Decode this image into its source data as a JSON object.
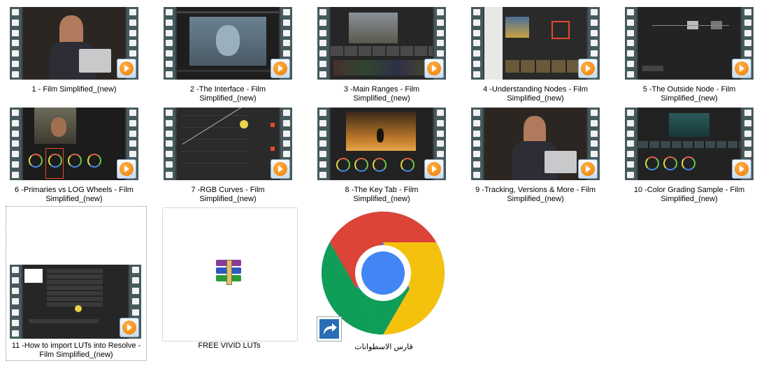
{
  "files": [
    {
      "name": "1 - Film Simplified_(new)"
    },
    {
      "name": "2 -The Interface - Film Simplified_(new)"
    },
    {
      "name": "3 -Main Ranges - Film Simplified_(new)"
    },
    {
      "name": "4 -Understanding Nodes - Film Simplified_(new)"
    },
    {
      "name": "5 -The Outside Node - Film Simplified_(new)"
    },
    {
      "name": "6 -Primaries vs LOG Wheels - Film Simplified_(new)"
    },
    {
      "name": "7 -RGB Curves - Film Simplified_(new)"
    },
    {
      "name": "8 -The Key Tab - Film Simplified_(new)"
    },
    {
      "name": "9 -Tracking, Versions & More - Film Simplified_(new)"
    },
    {
      "name": "10 -Color Grading Sample - Film Simplified_(new)"
    },
    {
      "name": "11 -How to import LUTs into Resolve - Film Simplified_(new)"
    },
    {
      "name": "FREE VIVID LUTs"
    },
    {
      "name": "قارس الاسطوانات"
    }
  ],
  "icons": {
    "video": "video-file-icon",
    "archive": "winrar-archive-icon",
    "shortcut": "chrome-shortcut-icon"
  },
  "colors": {
    "film_edge": "#465a5e",
    "play_orange": "#f07b00",
    "chrome_red": "#db4437",
    "chrome_yellow": "#f4c20d",
    "chrome_green": "#0f9d58",
    "chrome_blue": "#4285f4"
  }
}
